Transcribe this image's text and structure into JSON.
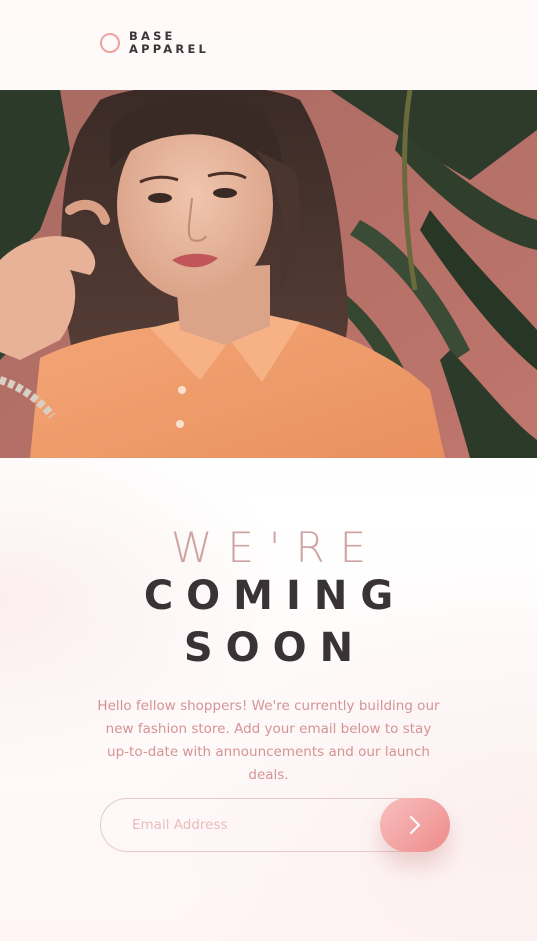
{
  "brand": {
    "line1": "BASE",
    "line2": "APPAREL",
    "accent": "#f2a1a1",
    "dark": "#3a3336"
  },
  "hero": {
    "image": "woman-in-orange-shirt-photo"
  },
  "headline": {
    "light": "WE'RE",
    "bold_line1": "COMING",
    "bold_line2": "SOON",
    "light_color": "#cfa3a4"
  },
  "description": "Hello fellow shoppers! We're currently building our new fashion store. Add your email below to stay up-to-date with announcements and our launch deals.",
  "form": {
    "email_placeholder": "Email Address",
    "submit_icon": "chevron-right-icon",
    "button_gradient": [
      "#f8bfbf",
      "#ee8b8b"
    ]
  }
}
